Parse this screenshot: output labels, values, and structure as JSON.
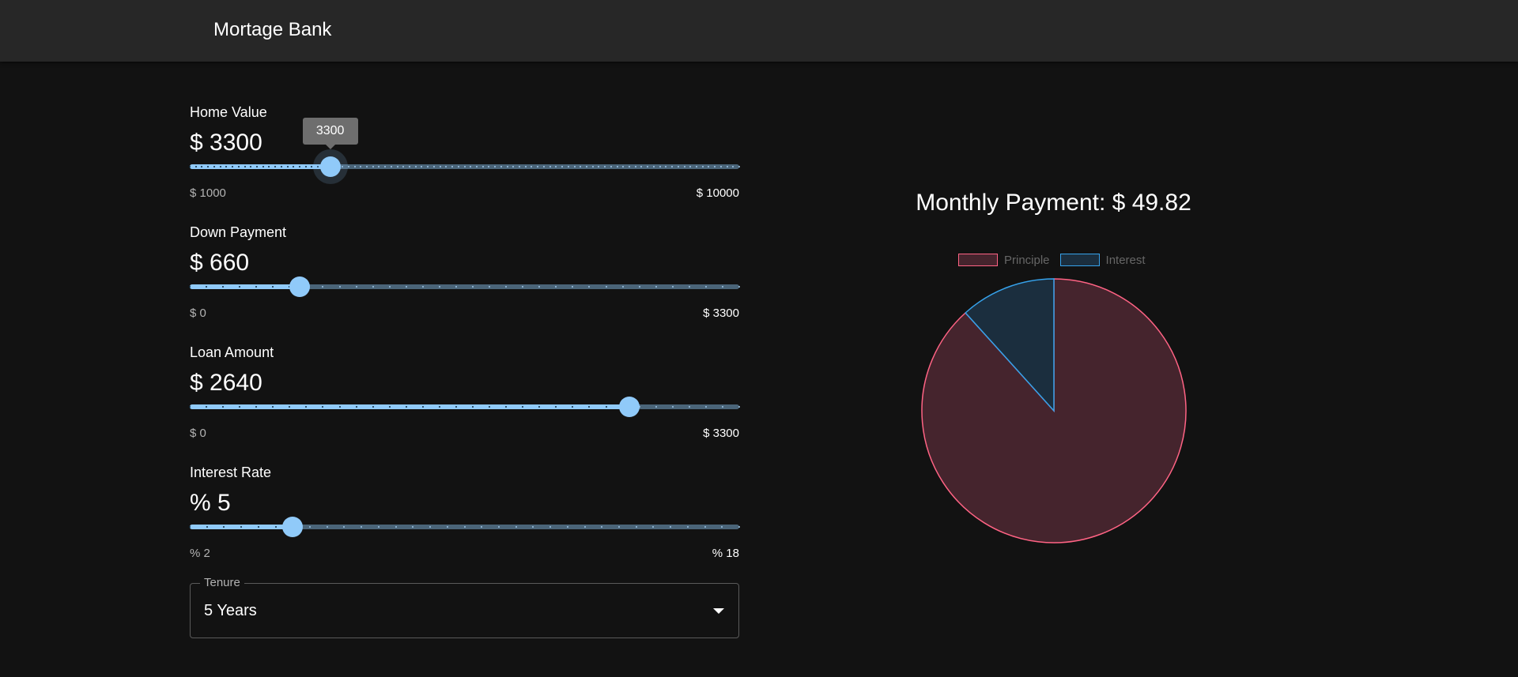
{
  "app": {
    "title": "Mortage Bank"
  },
  "sliders": [
    {
      "label": "Home Value",
      "value_display": "$ 3300",
      "value": 3300,
      "min": 1000,
      "max": 10000,
      "step": 100,
      "min_label": "$ 1000",
      "max_label": "$ 10000",
      "tooltip": "3300",
      "focused": true
    },
    {
      "label": "Down Payment",
      "value_display": "$ 660",
      "value": 660,
      "min": 0,
      "max": 3300,
      "step": 100,
      "min_label": "$ 0",
      "max_label": "$ 3300"
    },
    {
      "label": "Loan Amount",
      "value_display": "$ 2640",
      "value": 2640,
      "min": 0,
      "max": 3300,
      "step": 100,
      "min_label": "$ 0",
      "max_label": "$ 3300"
    },
    {
      "label": "Interest Rate",
      "value_display": "% 5",
      "value": 5,
      "min": 2,
      "max": 18,
      "step": 0.5,
      "min_label": "% 2",
      "max_label": "% 18"
    }
  ],
  "tenure": {
    "label": "Tenure",
    "value": "5 Years"
  },
  "payment": {
    "title": "Monthly Payment: $ 49.82"
  },
  "chart_data": {
    "type": "pie",
    "labels": [
      "Principle",
      "Interest"
    ],
    "values": [
      2640,
      349.2
    ],
    "colors": {
      "Principle": {
        "border": "#ff6384",
        "fill": "#45242d"
      },
      "Interest": {
        "border": "#36a2eb",
        "fill": "#1b2e3e"
      }
    },
    "legend": "top"
  },
  "colors": {
    "accent": "#90caf9",
    "appbar": "#272727",
    "background": "#121212"
  }
}
